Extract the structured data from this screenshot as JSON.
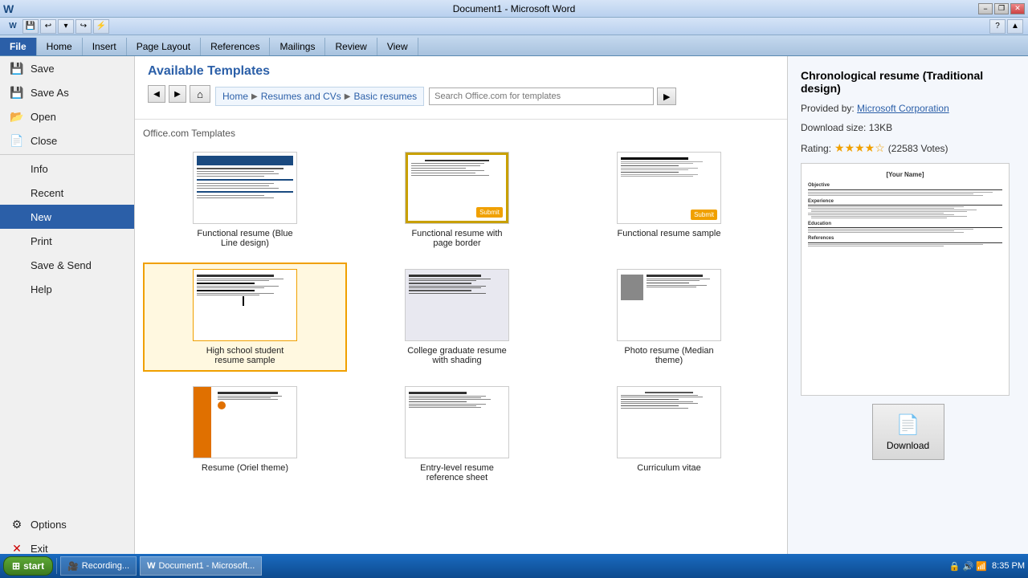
{
  "title_bar": {
    "title": "Document1  -  Microsoft Word",
    "minimize": "−",
    "restore": "❐",
    "close": "✕"
  },
  "qat": {
    "buttons": [
      "W",
      "💾",
      "↩",
      "↪",
      "⚡"
    ]
  },
  "ribbon": {
    "tabs": [
      "File",
      "Home",
      "Insert",
      "Page Layout",
      "References",
      "Mailings",
      "Review",
      "View"
    ],
    "active_tab": "File"
  },
  "sidebar": {
    "items": [
      {
        "id": "save",
        "label": "Save",
        "icon": "💾"
      },
      {
        "id": "save-as",
        "label": "Save As",
        "icon": "💾"
      },
      {
        "id": "open",
        "label": "Open",
        "icon": "📂"
      },
      {
        "id": "close",
        "label": "Close",
        "icon": "📄"
      },
      {
        "id": "info",
        "label": "Info",
        "icon": ""
      },
      {
        "id": "recent",
        "label": "Recent",
        "icon": ""
      },
      {
        "id": "new",
        "label": "New",
        "icon": ""
      },
      {
        "id": "print",
        "label": "Print",
        "icon": ""
      },
      {
        "id": "save-send",
        "label": "Save & Send",
        "icon": ""
      },
      {
        "id": "help",
        "label": "Help",
        "icon": ""
      },
      {
        "id": "options",
        "label": "Options",
        "icon": "⚙"
      },
      {
        "id": "exit",
        "label": "Exit",
        "icon": "✕"
      }
    ],
    "active": "new"
  },
  "content": {
    "title": "Available Templates",
    "search_placeholder": "Search Office.com for templates",
    "breadcrumb": [
      "Home",
      "Resumes and CVs",
      "Basic resumes"
    ],
    "office_label": "Office.com Templates",
    "templates": [
      {
        "id": "func-blue",
        "label": "Functional resume (Blue Line design)",
        "selected": false,
        "has_submit": false
      },
      {
        "id": "func-border",
        "label": "Functional resume with page border",
        "selected": false,
        "has_submit": true
      },
      {
        "id": "func-sample",
        "label": "Functional resume sample",
        "selected": false,
        "has_submit": true
      },
      {
        "id": "highschool",
        "label": "High school student resume sample",
        "selected": true,
        "has_submit": false
      },
      {
        "id": "college",
        "label": "College graduate resume with shading",
        "selected": false,
        "has_submit": false
      },
      {
        "id": "photo",
        "label": "Photo resume (Median theme)",
        "selected": false,
        "has_submit": false
      },
      {
        "id": "oriel",
        "label": "Resume (Oriel theme)",
        "selected": false,
        "has_submit": false
      },
      {
        "id": "entry-level",
        "label": "Entry-level resume reference sheet",
        "selected": false,
        "has_submit": false
      },
      {
        "id": "cv",
        "label": "Curriculum vitae",
        "selected": false,
        "has_submit": false
      }
    ]
  },
  "right_panel": {
    "title": "Chronological resume (Traditional design)",
    "provider_label": "Provided by:",
    "provider_name": "Microsoft Corporation",
    "size_label": "Download size:",
    "size_value": "13KB",
    "rating_label": "Rating:",
    "stars": "★★★★☆",
    "votes": "(22583 Votes)",
    "download_label": "Download"
  },
  "taskbar": {
    "start_label": "start",
    "items": [
      {
        "label": "Recording...",
        "icon": "🎥"
      },
      {
        "label": "Document1 - Microsoft...",
        "icon": "W"
      }
    ],
    "time": "8:35 PM"
  },
  "preview": {
    "name_placeholder": "[Your Name]",
    "section_labels": [
      "Objective",
      "Experience",
      "Education",
      "References"
    ]
  }
}
